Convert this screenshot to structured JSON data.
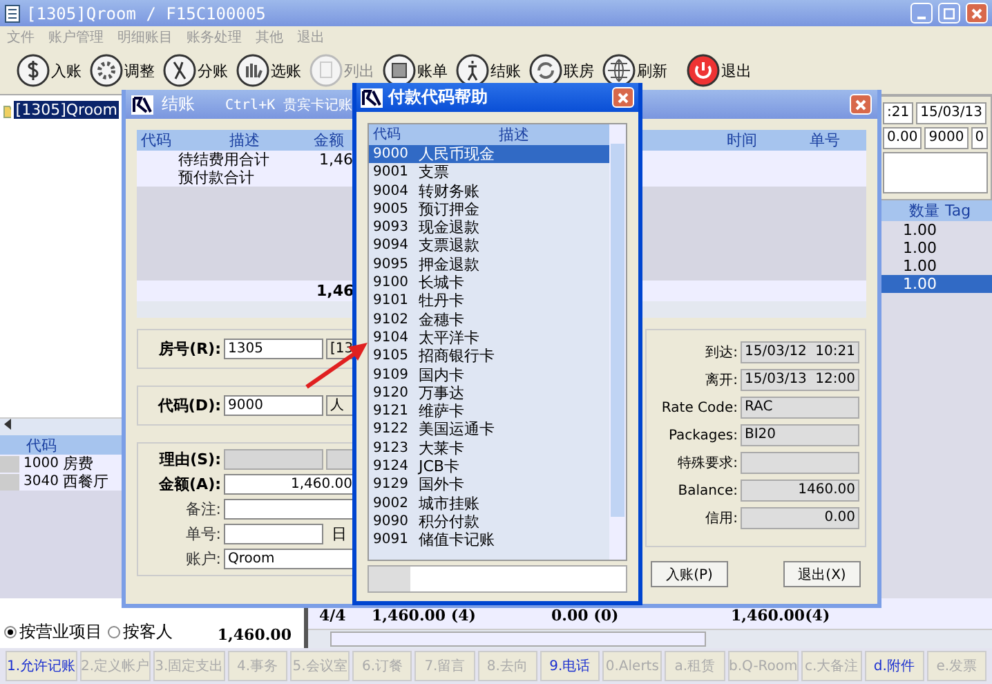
{
  "window": {
    "title": "[1305]Qroom / F15C100005"
  },
  "menu": [
    "文件",
    "账户管理",
    "明细账目",
    "账务处理",
    "其他",
    "退出"
  ],
  "toolbar": [
    {
      "label": "入账",
      "disabled": false
    },
    {
      "label": "调整",
      "disabled": false
    },
    {
      "label": "分账",
      "disabled": false
    },
    {
      "label": "选账",
      "disabled": false
    },
    {
      "label": "列出",
      "disabled": true
    },
    {
      "label": "账单",
      "disabled": false
    },
    {
      "label": "结账",
      "disabled": false
    },
    {
      "label": "联房",
      "disabled": false
    },
    {
      "label": "刷新",
      "disabled": false
    },
    {
      "label": "退出",
      "disabled": false
    }
  ],
  "tree": [
    {
      "label": "[1305]Qroom",
      "selected": true
    }
  ],
  "code_table": {
    "columns": [
      "代码"
    ],
    "rows": [
      {
        "code": "1000",
        "name": "房费"
      },
      {
        "code": "3040",
        "name": "西餐厅"
      }
    ]
  },
  "right_panel": {
    "time": ":21",
    "date": "15/03/13",
    "amount": "0.00",
    "code": "9000",
    "count": "0",
    "columns": [
      "数量",
      "Tag"
    ],
    "rows": [
      {
        "qty": "1.00",
        "selected": false
      },
      {
        "qty": "1.00",
        "selected": false
      },
      {
        "qty": "1.00",
        "selected": false
      },
      {
        "qty": "1.00",
        "selected": true
      }
    ]
  },
  "summary": {
    "radios": [
      {
        "label": "按营业项目",
        "selected": true
      },
      {
        "label": "按客人",
        "selected": false
      }
    ],
    "amount": "1,460.00",
    "count": "4/4",
    "totals": [
      "1,460.00 (4)",
      "0.00 (0)",
      "1,460.00(4)"
    ]
  },
  "tabs": [
    {
      "label": "1.允许记账",
      "disabled": false
    },
    {
      "label": "2.定义帐户",
      "disabled": true
    },
    {
      "label": "3.固定支出",
      "disabled": true
    },
    {
      "label": "4.事务",
      "disabled": true
    },
    {
      "label": "5.会议室",
      "disabled": true
    },
    {
      "label": "6.订餐",
      "disabled": true
    },
    {
      "label": "7.留言",
      "disabled": true
    },
    {
      "label": "8.去向",
      "disabled": true
    },
    {
      "label": "9.电话",
      "disabled": false
    },
    {
      "label": "0.Alerts",
      "disabled": true
    },
    {
      "label": "a.租赁",
      "disabled": true
    },
    {
      "label": "b.Q-Room",
      "disabled": true
    },
    {
      "label": "c.大备注",
      "disabled": true
    },
    {
      "label": "d.附件",
      "disabled": false
    },
    {
      "label": "e.发票",
      "disabled": true
    }
  ],
  "checkout_dialog": {
    "title": "结账",
    "shortcut": "Ctrl+K 贵宾卡记账",
    "columns": [
      "代码",
      "描述",
      "金额",
      "时间",
      "单号"
    ],
    "rows": [
      {
        "desc": "待结费用合计",
        "amount": "1,46"
      },
      {
        "desc": "预付款合计"
      }
    ],
    "total": "1,46",
    "room": {
      "label": "房号(R):",
      "value": "1305",
      "extra": "[13"
    },
    "code": {
      "label": "代码(D):",
      "value": "9000",
      "extra": "人"
    },
    "reason_label": "理由(S):",
    "amount": {
      "label": "金额(A):",
      "value": "1,460.00"
    },
    "note_label": "备注:",
    "number_label": "单号:",
    "date_label": "日",
    "account": {
      "label": "账户:",
      "value": "Qroom"
    },
    "info": [
      {
        "label": "到达:",
        "value": "15/03/12",
        "time": "10:21"
      },
      {
        "label": "离开:",
        "value": "15/03/13",
        "time": "12:00"
      },
      {
        "label": "Rate Code:",
        "value": "RAC"
      },
      {
        "label": "Packages:",
        "value": "BI20"
      },
      {
        "label": "特殊要求:"
      },
      {
        "label": "Balance:",
        "value": "1460.00",
        "kind": "amount"
      },
      {
        "label": "信用:",
        "value": "0.00",
        "kind": "amount"
      }
    ],
    "buttons": [
      "入账(P)",
      "退出(X)"
    ]
  },
  "payment_popup": {
    "title": "付款代码帮助",
    "columns": [
      "代码",
      "描述"
    ],
    "rows": [
      {
        "code": "9000",
        "desc": "人民币现金",
        "selected": true
      },
      {
        "code": "9001",
        "desc": "支票",
        "selected": false
      },
      {
        "code": "9004",
        "desc": "转财务账",
        "selected": false
      },
      {
        "code": "9005",
        "desc": "预订押金",
        "selected": false
      },
      {
        "code": "9093",
        "desc": "现金退款",
        "selected": false
      },
      {
        "code": "9094",
        "desc": "支票退款",
        "selected": false
      },
      {
        "code": "9095",
        "desc": "押金退款",
        "selected": false
      },
      {
        "code": "9100",
        "desc": "长城卡",
        "selected": false
      },
      {
        "code": "9101",
        "desc": "牡丹卡",
        "selected": false
      },
      {
        "code": "9102",
        "desc": "金穗卡",
        "selected": false
      },
      {
        "code": "9104",
        "desc": "太平洋卡",
        "selected": false
      },
      {
        "code": "9105",
        "desc": "招商银行卡",
        "selected": false
      },
      {
        "code": "9109",
        "desc": "国内卡",
        "selected": false
      },
      {
        "code": "9120",
        "desc": "万事达",
        "selected": false
      },
      {
        "code": "9121",
        "desc": "维萨卡",
        "selected": false
      },
      {
        "code": "9122",
        "desc": "美国运通卡",
        "selected": false
      },
      {
        "code": "9123",
        "desc": "大莱卡",
        "selected": false
      },
      {
        "code": "9124",
        "desc": "JCB卡",
        "selected": false
      },
      {
        "code": "9129",
        "desc": "国外卡",
        "selected": false
      },
      {
        "code": "9002",
        "desc": "城市挂账",
        "selected": false
      },
      {
        "code": "9090",
        "desc": "积分付款",
        "selected": false
      },
      {
        "code": "9091",
        "desc": "储值卡记账",
        "selected": false
      }
    ]
  }
}
